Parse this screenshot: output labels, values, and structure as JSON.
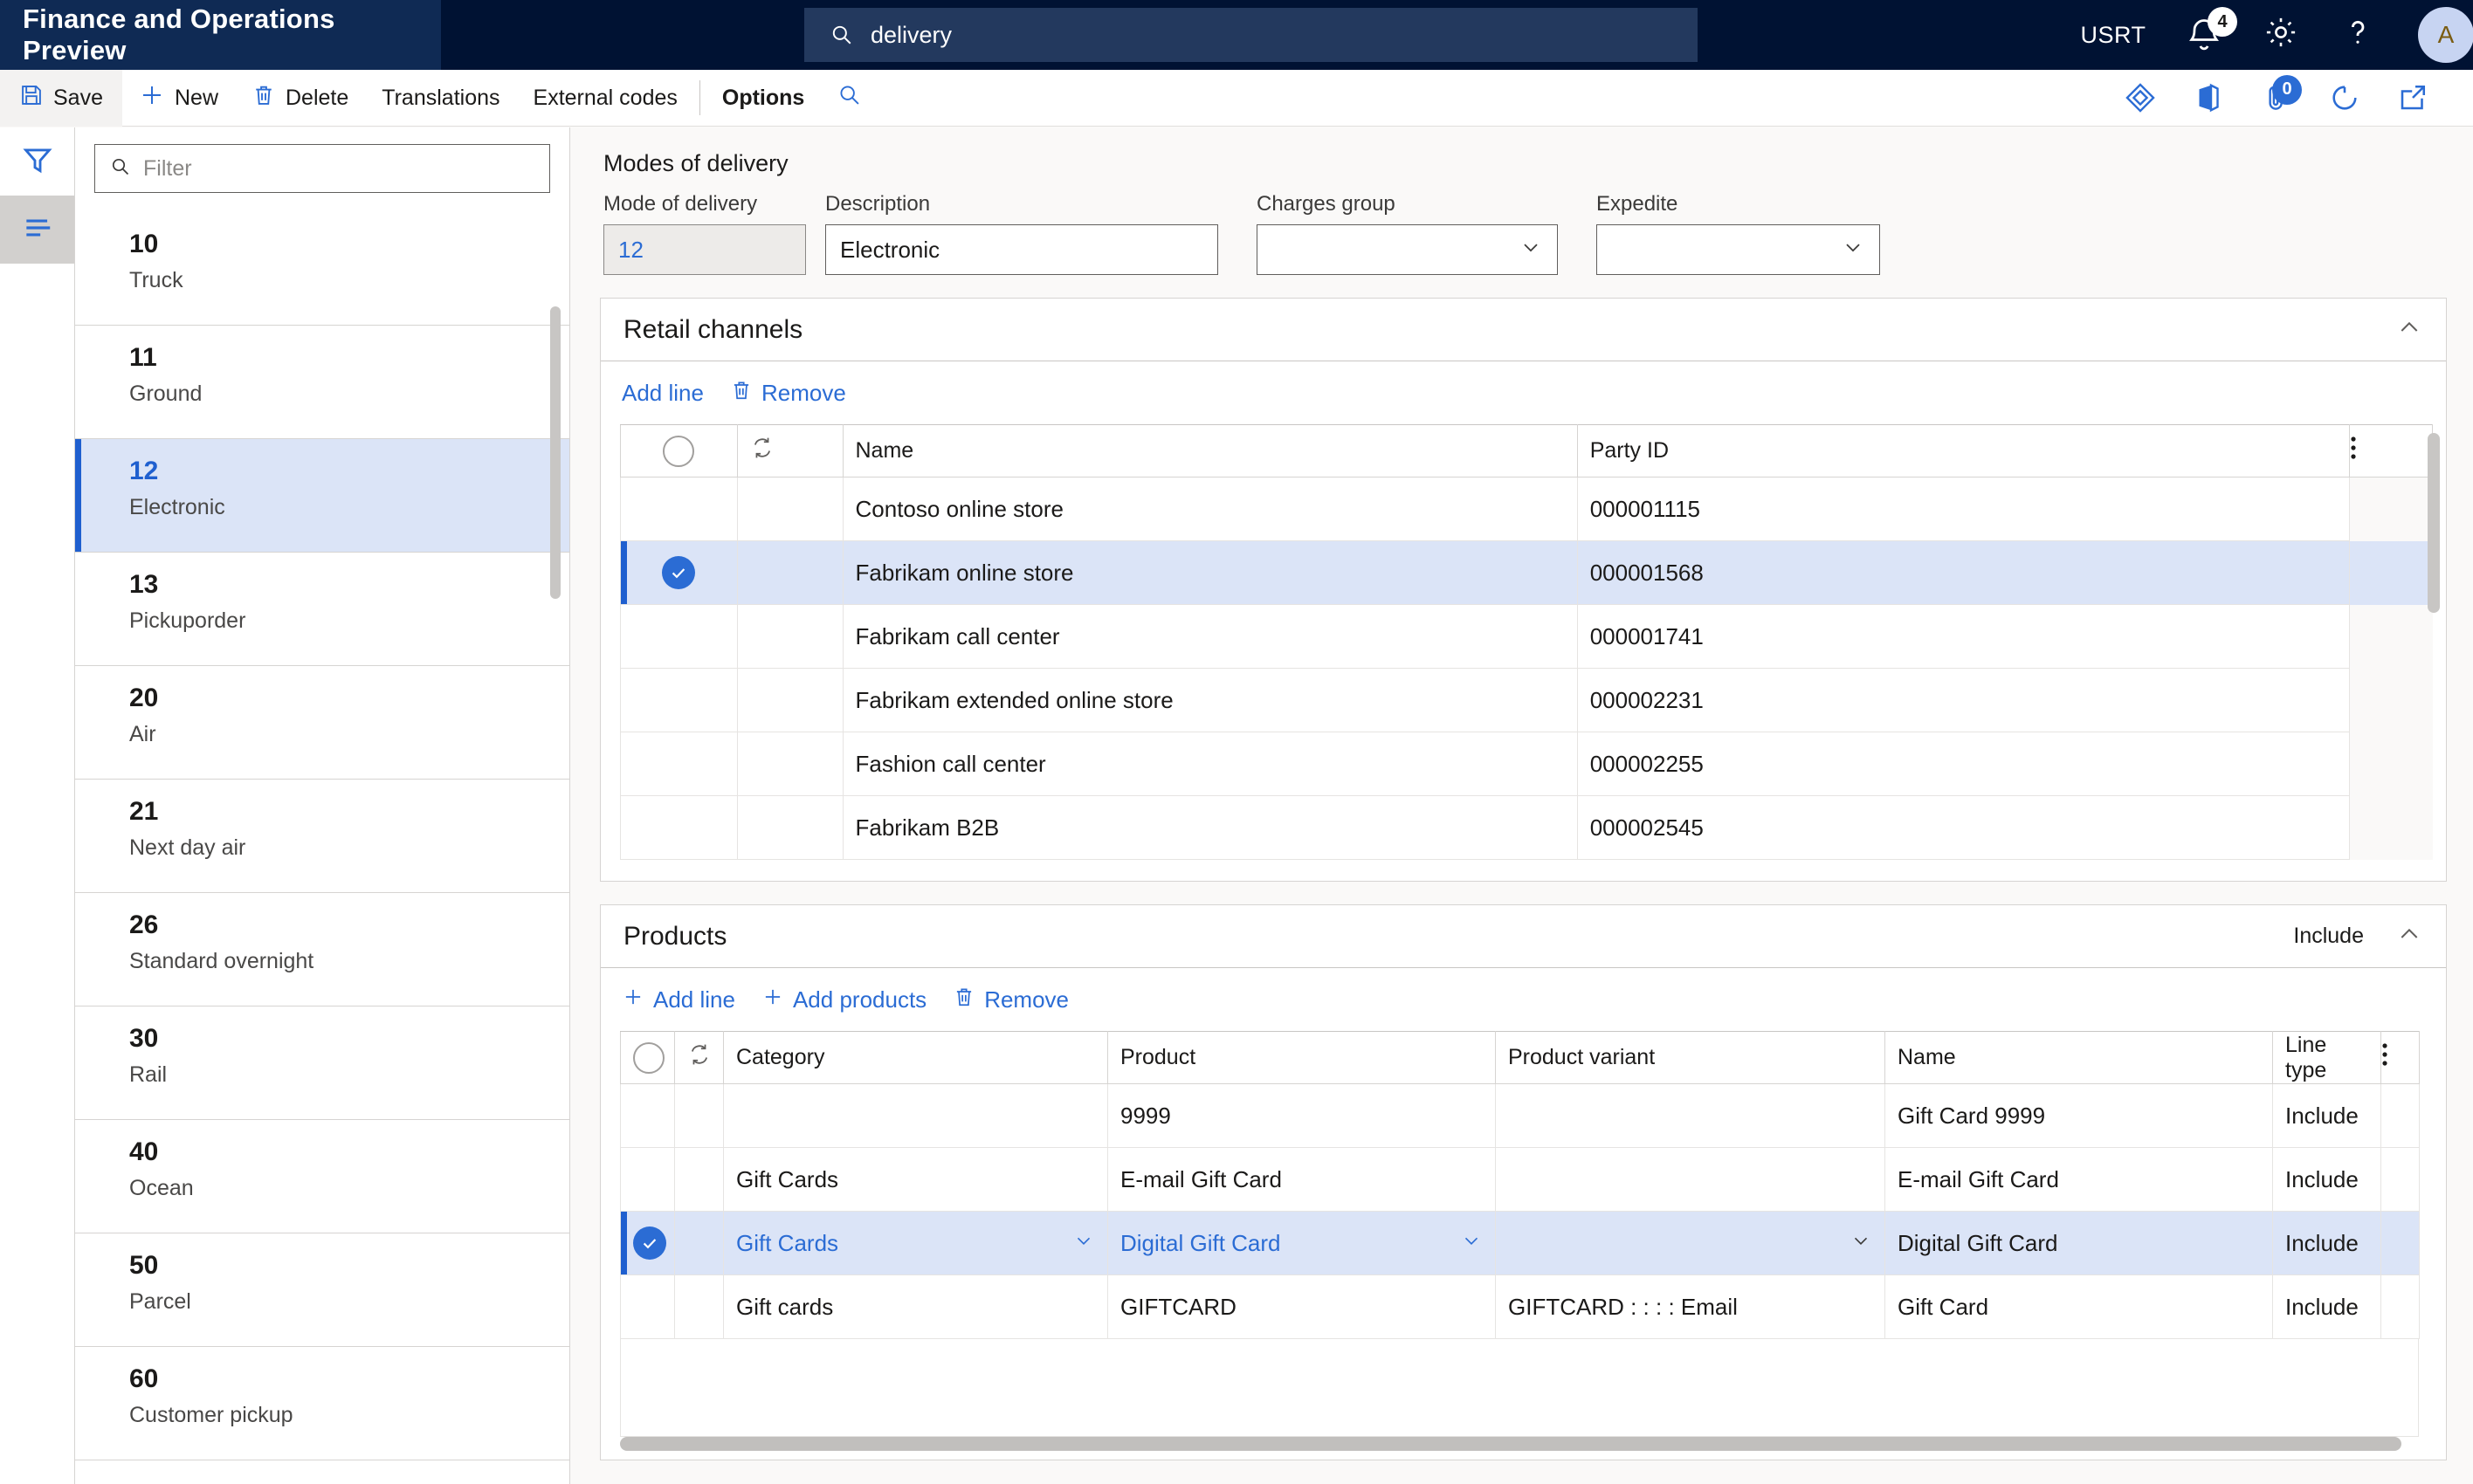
{
  "topnav": {
    "brand": "Finance and Operations Preview",
    "search": {
      "value": "delivery",
      "icon": "search-icon"
    },
    "company": "USRT",
    "notifications_count": "4",
    "settings_icon": "gear-icon",
    "help_icon": "help-icon",
    "avatar_initial": "A"
  },
  "actionpane": {
    "save": "Save",
    "new": "New",
    "delete": "Delete",
    "translations": "Translations",
    "external_codes": "External codes",
    "options": "Options",
    "search_icon": "search-icon",
    "right_icons": [
      {
        "name": "power-apps-icon"
      },
      {
        "name": "office-apps-icon"
      },
      {
        "name": "attachment-icon",
        "badge": "0"
      },
      {
        "name": "refresh-icon"
      },
      {
        "name": "open-in-new-window-icon"
      }
    ]
  },
  "rail": {
    "filter_icon": "filter-icon",
    "list_icon": "list-view-icon"
  },
  "navpane": {
    "filter_placeholder": "Filter",
    "filter_icon": "search-icon",
    "items": [
      {
        "code": "10",
        "desc": "Truck"
      },
      {
        "code": "11",
        "desc": "Ground"
      },
      {
        "code": "12",
        "desc": "Electronic"
      },
      {
        "code": "13",
        "desc": "Pickuporder"
      },
      {
        "code": "20",
        "desc": "Air"
      },
      {
        "code": "21",
        "desc": "Next day air"
      },
      {
        "code": "26",
        "desc": "Standard overnight"
      },
      {
        "code": "30",
        "desc": "Rail"
      },
      {
        "code": "40",
        "desc": "Ocean"
      },
      {
        "code": "50",
        "desc": "Parcel"
      },
      {
        "code": "60",
        "desc": "Customer pickup"
      }
    ],
    "selected_index": 2
  },
  "main": {
    "page_title": "Modes of delivery",
    "fields": [
      {
        "label": "Mode of delivery",
        "value": "12",
        "readonly": true,
        "chevron": false
      },
      {
        "label": "Description",
        "value": "Electronic",
        "readonly": false,
        "chevron": false
      },
      {
        "label": "Charges group",
        "value": "",
        "readonly": false,
        "chevron": true
      },
      {
        "label": "Expedite",
        "value": "",
        "readonly": false,
        "chevron": true
      }
    ],
    "retail_channels": {
      "title": "Retail channels",
      "collapse_icon": "chevron-up-icon",
      "toolbar": {
        "add_line": "Add line",
        "remove": "Remove",
        "remove_icon": "trash-icon"
      },
      "columns": [
        "Name",
        "Party ID"
      ],
      "rows": [
        {
          "name": "Contoso online store",
          "party_id": "000001115",
          "selected": false
        },
        {
          "name": "Fabrikam online store",
          "party_id": "000001568",
          "selected": true
        },
        {
          "name": "Fabrikam call center",
          "party_id": "000001741",
          "selected": false
        },
        {
          "name": "Fabrikam extended online store",
          "party_id": "000002231",
          "selected": false
        },
        {
          "name": "Fashion call center",
          "party_id": "000002255",
          "selected": false
        },
        {
          "name": "Fabrikam B2B",
          "party_id": "000002545",
          "selected": false
        }
      ]
    },
    "products": {
      "title": "Products",
      "summary": "Include",
      "collapse_icon": "chevron-up-icon",
      "toolbar": {
        "add_line": "Add line",
        "add_products": "Add products",
        "remove": "Remove",
        "remove_icon": "trash-icon"
      },
      "columns": [
        "Category",
        "Product",
        "Product variant",
        "Name",
        "Line type"
      ],
      "rows": [
        {
          "category": "",
          "product": "9999",
          "variant": "",
          "name": "Gift Card 9999",
          "line_type": "Include",
          "selected": false
        },
        {
          "category": "Gift Cards",
          "product": "E-mail Gift Card",
          "variant": "",
          "name": "E-mail Gift Card",
          "line_type": "Include",
          "selected": false
        },
        {
          "category": "Gift Cards",
          "product": "Digital Gift Card",
          "variant": "",
          "name": "Digital Gift Card",
          "line_type": "Include",
          "selected": true
        },
        {
          "category": "Gift cards",
          "product": "GIFTCARD",
          "variant": "GIFTCARD : : : : Email",
          "name": "Gift Card",
          "line_type": "Include",
          "selected": false
        }
      ]
    }
  },
  "colors": {
    "nav_bg": "#001233",
    "brand_bg": "#0f2a54",
    "accent": "#2b6cd4",
    "selection_bg": "#dbe4f7",
    "selection_bar": "#1f5fcf"
  }
}
